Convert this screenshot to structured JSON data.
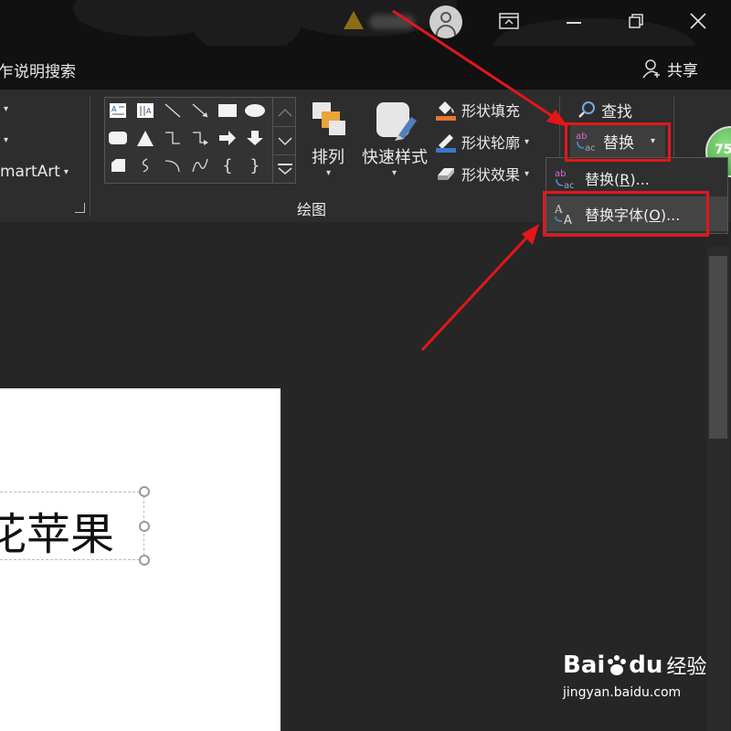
{
  "titlebar": {
    "share_label": "共享"
  },
  "menubar": {
    "tell_me_text": "乍说明搜索"
  },
  "ribbon": {
    "smartart_label": "martArt",
    "arrange_label": "排列",
    "quick_styles_label": "快速样式",
    "shape_fill_label": "形状填充",
    "shape_outline_label": "形状轮廓",
    "shape_effects_label": "形状效果",
    "drawing_group_label": "绘图",
    "find_label": "查找",
    "replace_label": "替换",
    "badge_text": "75"
  },
  "replace_menu": {
    "items": [
      {
        "label_before": "替换(",
        "mnemonic": "R",
        "label_after": ")..."
      },
      {
        "label_before": "替换字体(",
        "mnemonic": "O",
        "label_after": ")..."
      }
    ]
  },
  "slide": {
    "text": "花苹果"
  },
  "watermark": {
    "brand": "Bai",
    "brand2": "du",
    "product": "经验",
    "url": "jingyan.baidu.com"
  },
  "colors": {
    "annotation_red": "#e4161a",
    "ribbon_bg": "#2d2d2d",
    "titlebar_bg": "#111111"
  }
}
